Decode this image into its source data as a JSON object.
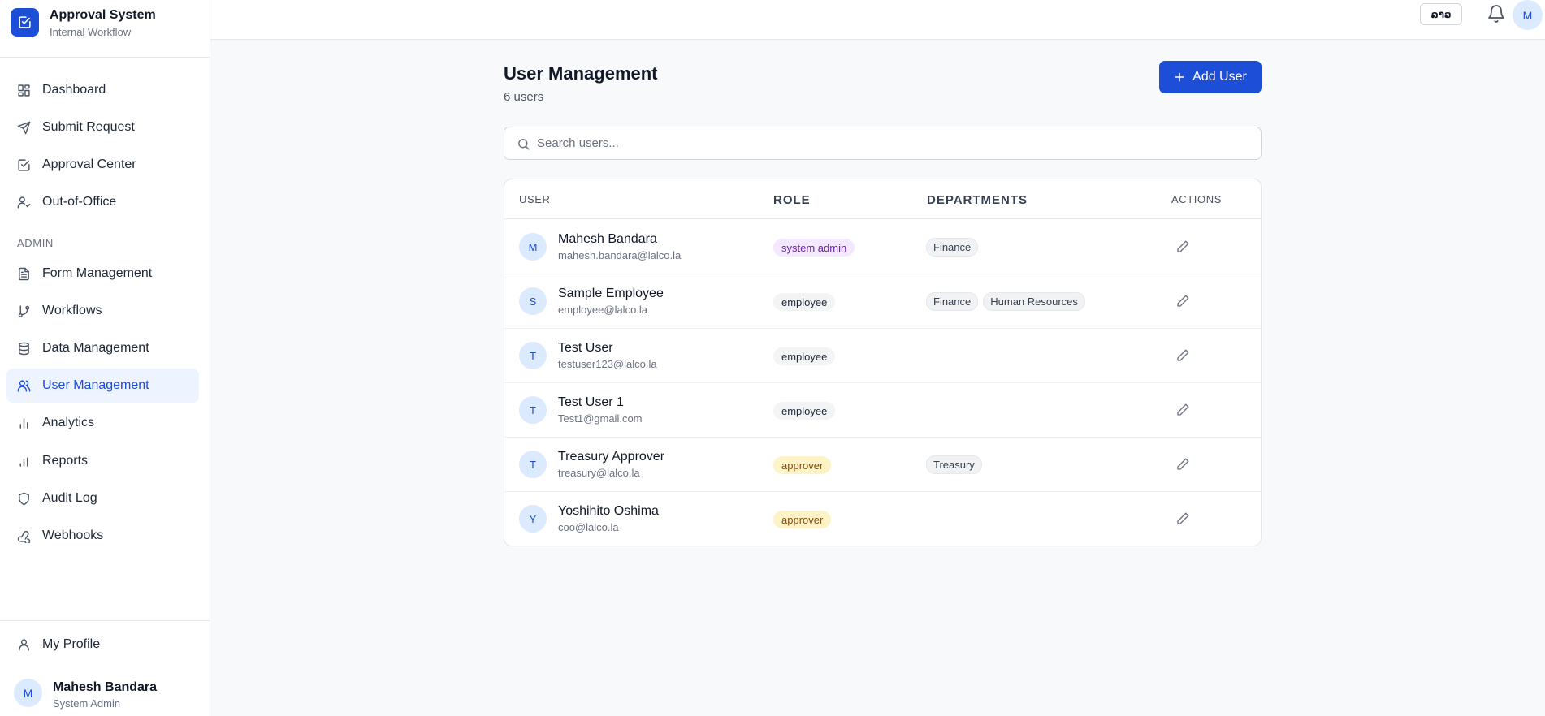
{
  "brand": {
    "title": "Approval System",
    "subtitle": "Internal Workflow"
  },
  "nav": {
    "main": [
      {
        "label": "Dashboard",
        "icon": "dashboard-icon"
      },
      {
        "label": "Submit Request",
        "icon": "send-icon"
      },
      {
        "label": "Approval Center",
        "icon": "check-square-icon"
      },
      {
        "label": "Out-of-Office",
        "icon": "user-away-icon"
      }
    ],
    "section_label": "ADMIN",
    "admin": [
      {
        "label": "Form Management",
        "icon": "file-text-icon"
      },
      {
        "label": "Workflows",
        "icon": "git-branch-icon"
      },
      {
        "label": "Data Management",
        "icon": "database-icon"
      },
      {
        "label": "User Management",
        "icon": "users-icon",
        "active": true
      },
      {
        "label": "Analytics",
        "icon": "bar-chart-icon"
      },
      {
        "label": "Reports",
        "icon": "bar-chart-icon"
      },
      {
        "label": "Audit Log",
        "icon": "shield-icon"
      },
      {
        "label": "Webhooks",
        "icon": "webhook-icon"
      }
    ],
    "footer": {
      "label": "My Profile",
      "icon": "user-icon"
    }
  },
  "current_user": {
    "initial": "M",
    "name": "Mahesh Bandara",
    "role": "System Admin"
  },
  "topbar": {
    "lang_label": "ລາວ",
    "avatar_initial": "M"
  },
  "page": {
    "title": "User Management",
    "count": "6 users",
    "add_label": "Add User"
  },
  "search": {
    "placeholder": "Search users..."
  },
  "table": {
    "headers": {
      "user": "USER",
      "role": "ROLE",
      "departments": "DEPARTMENTS",
      "actions": "ACTIONS"
    },
    "rows": [
      {
        "initial": "M",
        "name": "Mahesh Bandara",
        "email": "mahesh.bandara@lalco.la",
        "role": "system admin",
        "departments": [
          "Finance"
        ]
      },
      {
        "initial": "S",
        "name": "Sample Employee",
        "email": "employee@lalco.la",
        "role": "employee",
        "departments": [
          "Finance",
          "Human Resources"
        ]
      },
      {
        "initial": "T",
        "name": "Test User",
        "email": "testuser123@lalco.la",
        "role": "employee",
        "departments": []
      },
      {
        "initial": "T",
        "name": "Test User 1",
        "email": "Test1@gmail.com",
        "role": "employee",
        "departments": []
      },
      {
        "initial": "T",
        "name": "Treasury Approver",
        "email": "treasury@lalco.la",
        "role": "approver",
        "departments": [
          "Treasury"
        ]
      },
      {
        "initial": "Y",
        "name": "Yoshihito Oshima",
        "email": "coo@lalco.la",
        "role": "approver",
        "departments": []
      }
    ]
  },
  "colors": {
    "accent": "#1d4ed8",
    "system_admin_bg": "#f3e8ff",
    "system_admin_fg": "#6b21a8",
    "employee_bg": "#f3f4f6",
    "employee_fg": "#1f2937",
    "approver_bg": "#fef3c7",
    "approver_fg": "#854d0e"
  }
}
